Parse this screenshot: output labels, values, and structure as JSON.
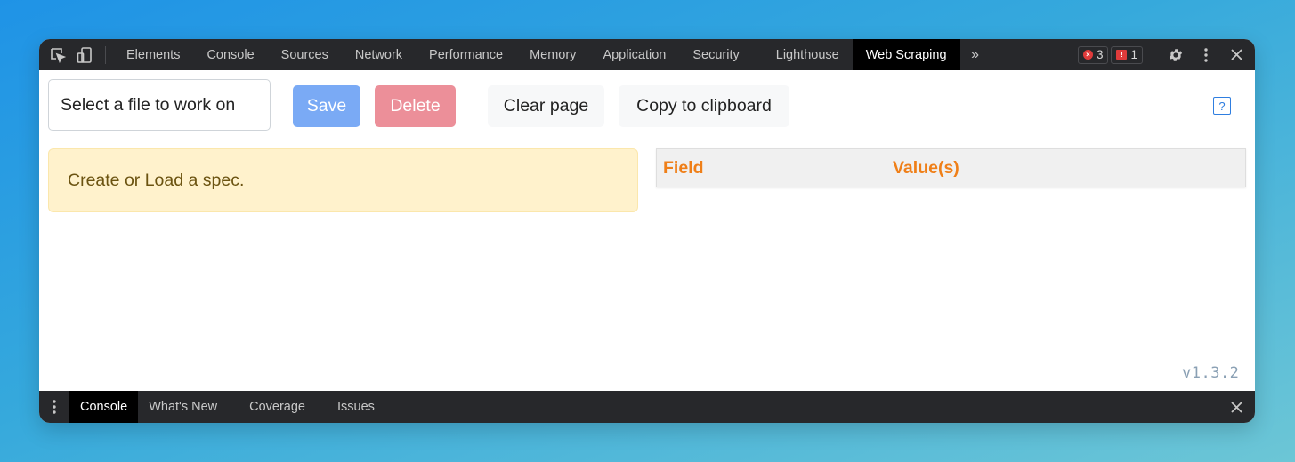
{
  "topbar": {
    "tabs": [
      {
        "label": "Elements"
      },
      {
        "label": "Console"
      },
      {
        "label": "Sources"
      },
      {
        "label": "Network"
      },
      {
        "label": "Performance"
      },
      {
        "label": "Memory"
      },
      {
        "label": "Application"
      },
      {
        "label": "Security"
      },
      {
        "label": "Lighthouse"
      },
      {
        "label": "Web Scraping",
        "active": true
      }
    ],
    "more_icon": "double-chevron-right-icon",
    "error_count": "3",
    "issue_count": "1"
  },
  "toolbar": {
    "file_select_value": "Select a file to work on",
    "save_label": "Save",
    "delete_label": "Delete",
    "clear_label": "Clear page",
    "copy_label": "Copy to clipboard",
    "help_label": "?"
  },
  "alert": {
    "text": "Create or Load a spec."
  },
  "table": {
    "columns": [
      "Field",
      "Value(s)"
    ]
  },
  "version": "v1.3.2",
  "bottombar": {
    "tabs": [
      {
        "label": "Console",
        "active": true
      },
      {
        "label": "What's New"
      },
      {
        "label": "Coverage"
      },
      {
        "label": "Issues"
      }
    ]
  },
  "colors": {
    "save": "#7aaaf5",
    "delete": "#ec8f99",
    "alert_bg": "#fff2cc",
    "table_header_text": "#ef7f18",
    "devtools_bar": "#27282b"
  }
}
